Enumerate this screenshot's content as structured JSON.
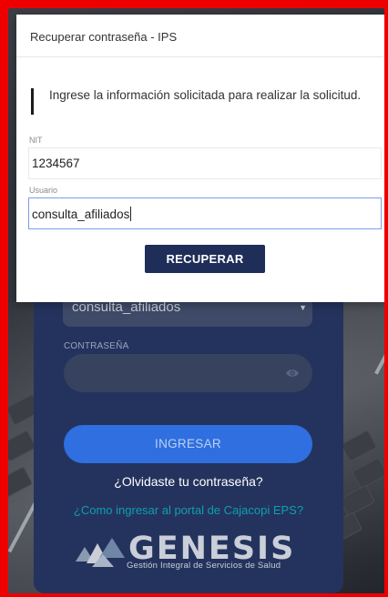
{
  "modal": {
    "title": "Recuperar contraseña - IPS",
    "instruction": "Ingrese la información solicitada para realizar la solicitud.",
    "nit_label": "NIT",
    "nit_value": "1234567",
    "usuario_label": "Usuario",
    "usuario_value": "consulta_afiliados",
    "recuperar_label": "RECUPERAR"
  },
  "login": {
    "user_select_value": "consulta_afiliados",
    "password_label": "CONTRASEÑA",
    "ingresar_label": "INGRESAR",
    "forgot_link": "¿Olvidaste tu contraseña?",
    "portal_link": "¿Como ingresar al portal de Cajacopi EPS?",
    "logo_text": "GENESIS",
    "logo_subtitle": "Gestión Integral de Servicios de Salud"
  },
  "colors": {
    "frame": "#ee0000",
    "login_card": "#24335d",
    "ingresar_button": "#2f6fe0",
    "portal_link": "#0e9fb0",
    "recuperar_button": "#1f2d59",
    "focus_border": "#7e9de8"
  },
  "icons": {
    "password_toggle": "eye-icon",
    "select_dropdown": "caret-down-icon",
    "logo": "genesis-logo-icon"
  }
}
